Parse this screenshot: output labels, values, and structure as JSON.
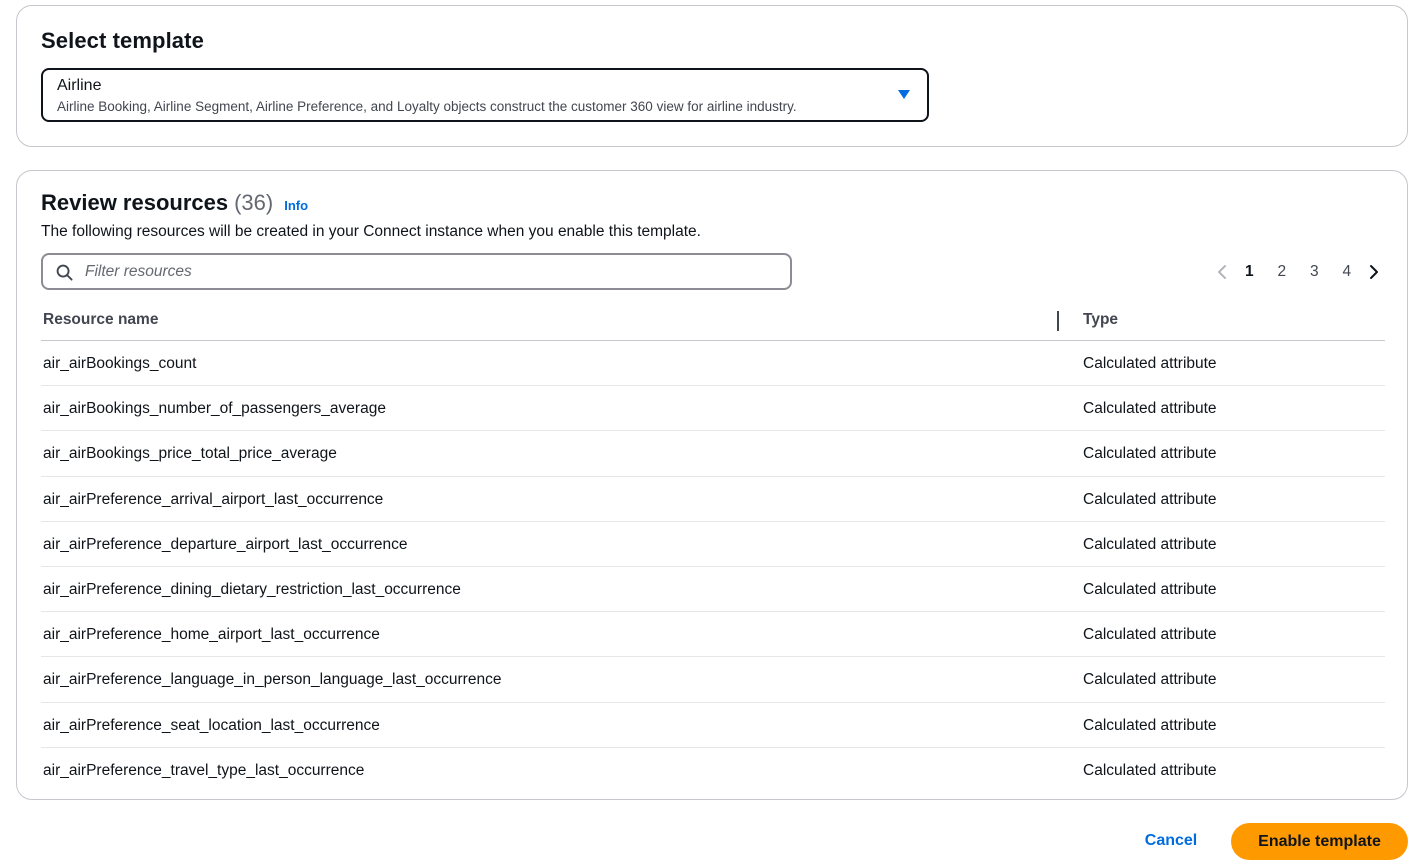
{
  "select_template": {
    "heading": "Select template",
    "selected_label": "Airline",
    "selected_description": "Airline Booking, Airline Segment, Airline Preference, and Loyalty objects construct the customer 360 view for airline industry."
  },
  "review": {
    "title": "Review resources",
    "count": "(36)",
    "info_link": "Info",
    "description": "The following resources will be created in your Connect instance when you enable this template.",
    "filter_placeholder": "Filter resources",
    "pagination": {
      "pages": [
        "1",
        "2",
        "3",
        "4"
      ],
      "current": "1"
    },
    "columns": {
      "name": "Resource name",
      "type": "Type"
    },
    "rows": [
      {
        "name": "air_airBookings_count",
        "type": "Calculated attribute"
      },
      {
        "name": "air_airBookings_number_of_passengers_average",
        "type": "Calculated attribute"
      },
      {
        "name": "air_airBookings_price_total_price_average",
        "type": "Calculated attribute"
      },
      {
        "name": "air_airPreference_arrival_airport_last_occurrence",
        "type": "Calculated attribute"
      },
      {
        "name": "air_airPreference_departure_airport_last_occurrence",
        "type": "Calculated attribute"
      },
      {
        "name": "air_airPreference_dining_dietary_restriction_last_occurrence",
        "type": "Calculated attribute"
      },
      {
        "name": "air_airPreference_home_airport_last_occurrence",
        "type": "Calculated attribute"
      },
      {
        "name": "air_airPreference_language_in_person_language_last_occurrence",
        "type": "Calculated attribute"
      },
      {
        "name": "air_airPreference_seat_location_last_occurrence",
        "type": "Calculated attribute"
      },
      {
        "name": "air_airPreference_travel_type_last_occurrence",
        "type": "Calculated attribute"
      }
    ]
  },
  "footer": {
    "cancel_label": "Cancel",
    "enable_label": "Enable template"
  },
  "colors": {
    "link_blue": "#006ce0",
    "primary_orange": "#ff9900",
    "text_primary": "#0f141a",
    "border": "#c6c6cd"
  },
  "icons": {
    "dropdown": "caret-down-icon",
    "search": "search-icon",
    "prev": "chevron-left-icon",
    "next": "chevron-right-icon"
  }
}
